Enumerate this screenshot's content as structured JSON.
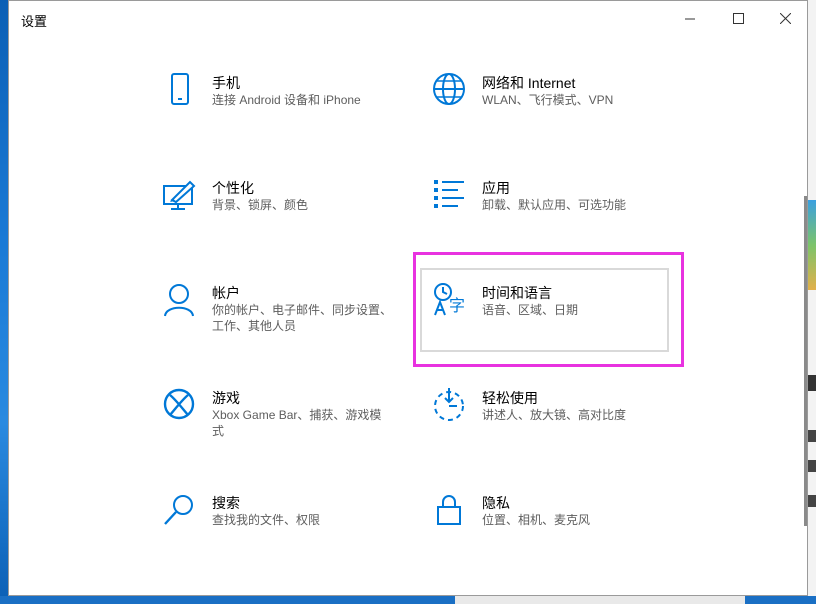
{
  "window": {
    "title": "设置",
    "controls": {
      "minimize": "minimize",
      "maximize": "maximize",
      "close": "close"
    }
  },
  "tiles": [
    {
      "name": "手机",
      "desc": "连接 Android 设备和 iPhone",
      "icon": "phone-icon"
    },
    {
      "name": "网络和 Internet",
      "desc": "WLAN、飞行模式、VPN",
      "icon": "globe-icon"
    },
    {
      "name": "个性化",
      "desc": "背景、锁屏、颜色",
      "icon": "personalization-icon"
    },
    {
      "name": "应用",
      "desc": "卸载、默认应用、可选功能",
      "icon": "apps-list-icon"
    },
    {
      "name": "帐户",
      "desc": "你的帐户、电子邮件、同步设置、工作、其他人员",
      "icon": "person-icon"
    },
    {
      "name": "时间和语言",
      "desc": "语音、区域、日期",
      "icon": "time-language-icon"
    },
    {
      "name": "游戏",
      "desc": "Xbox Game Bar、捕获、游戏模式",
      "icon": "xbox-icon"
    },
    {
      "name": "轻松使用",
      "desc": "讲述人、放大镜、高对比度",
      "icon": "ease-of-access-icon"
    },
    {
      "name": "搜索",
      "desc": "查找我的文件、权限",
      "icon": "search-icon"
    },
    {
      "name": "隐私",
      "desc": "位置、相机、麦克风",
      "icon": "lock-icon"
    }
  ],
  "colors": {
    "accent": "#0078d7",
    "highlight": "#e832e0"
  }
}
